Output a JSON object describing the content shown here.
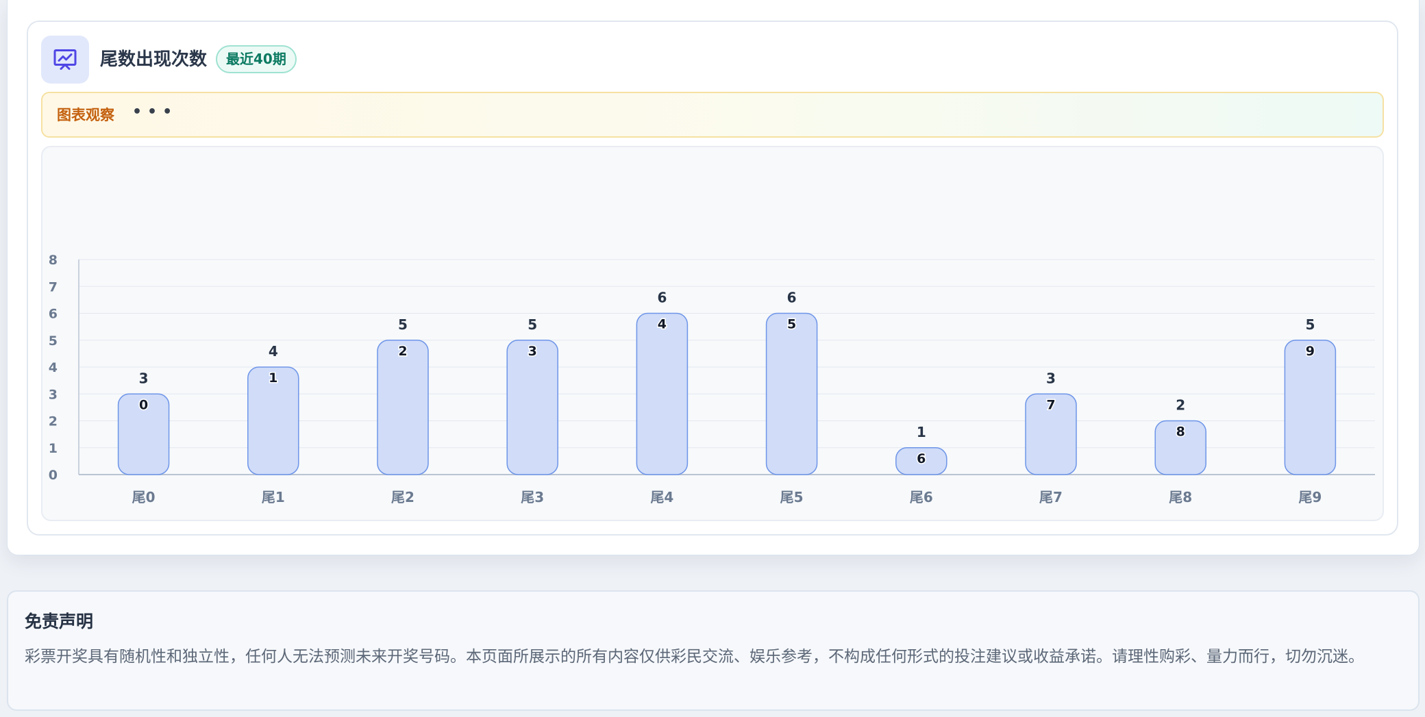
{
  "header": {
    "title": "尾数出现次数",
    "badge": "最近40期",
    "icon": "chart-presentation-icon"
  },
  "observation": {
    "label": "图表观察",
    "dots": "•••"
  },
  "colors": {
    "bar_fill": "#d0dcf8",
    "bar_stroke": "#6e95e8",
    "icon_accent": "#4f46e5",
    "axis_text": "#6b7a90",
    "value_text": "#283446"
  },
  "chart_data": {
    "type": "bar",
    "categories": [
      "尾0",
      "尾1",
      "尾2",
      "尾3",
      "尾4",
      "尾5",
      "尾6",
      "尾7",
      "尾8",
      "尾9"
    ],
    "values": [
      3,
      4,
      5,
      5,
      6,
      6,
      1,
      3,
      2,
      5
    ],
    "inner_labels": [
      "0",
      "1",
      "2",
      "3",
      "4",
      "5",
      "6",
      "7",
      "8",
      "9"
    ],
    "y_ticks": [
      "0",
      "1",
      "2",
      "3",
      "4",
      "5",
      "6",
      "7",
      "8"
    ],
    "ylim": [
      0,
      8
    ],
    "grid": true
  },
  "disclaimer": {
    "title": "免责声明",
    "text": "彩票开奖具有随机性和独立性，任何人无法预测未来开奖号码。本页面所展示的所有内容仅供彩民交流、娱乐参考，不构成任何形式的投注建议或收益承诺。请理性购彩、量力而行，切勿沉迷。"
  }
}
